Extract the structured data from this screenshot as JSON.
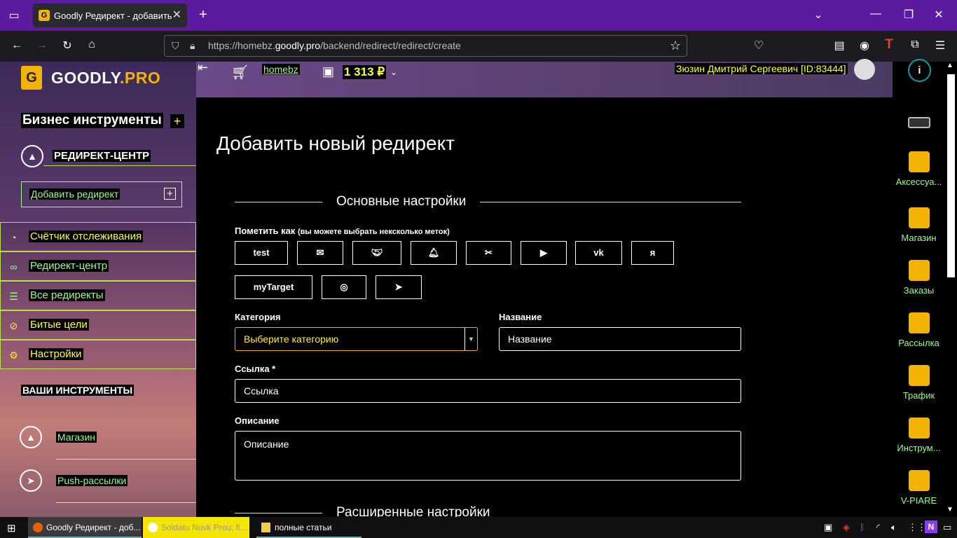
{
  "browser": {
    "tab_title": "Goodly Редирект - добавить",
    "url_prefix": "https://homebz.",
    "url_domain": "goodly.pro",
    "url_path": "/backend/redirect/redirect/create"
  },
  "sidebar": {
    "logo_text_a": "GOODLY",
    "logo_text_b": ".PRO",
    "section_title": "Бизнес инструменты",
    "section_expand": "+",
    "group_label": "РЕДИРЕКТ-ЦЕНТР",
    "add_redirect": "Добавить редирект",
    "items": [
      {
        "label": "Счётчик отслеживания",
        "icon": "gauge-icon"
      },
      {
        "label": "Редирект-центр",
        "icon": "link-icon"
      },
      {
        "label": "Все редиректы",
        "icon": "list-icon"
      },
      {
        "label": "Битые цели",
        "icon": "ban-icon"
      },
      {
        "label": "Настройки",
        "icon": "gear-icon"
      }
    ],
    "tools_title": "ВАШИ ИНСТРУМЕНТЫ",
    "tools": [
      {
        "label": "Магазин",
        "icon": "bag-icon"
      },
      {
        "label": "Push-рассылки",
        "icon": "send-icon"
      }
    ]
  },
  "header": {
    "shop_link": "homebz",
    "balance": "1 313 ₽",
    "user": "Зюзин Дмитрий Сергеевич [ID:83444]"
  },
  "rightbar": {
    "items": [
      {
        "label": "Аксессуа..."
      },
      {
        "label": "Магазин"
      },
      {
        "label": "Заказы"
      },
      {
        "label": "Рассылка"
      },
      {
        "label": "Трафик"
      },
      {
        "label": "Инструм..."
      },
      {
        "label": "V-PIARE"
      }
    ]
  },
  "main": {
    "page_title": "Добавить новый редирект",
    "section_basic": "Основные настройки",
    "tags_label": "Пометить как",
    "tags_hint": "(вы можете выбрать нексколько меток)",
    "tags": [
      "test",
      "myTarget"
    ],
    "category_label": "Категория",
    "category_placeholder": "Выберите категорию",
    "name_label": "Название",
    "name_placeholder": "Название",
    "link_label": "Ссылка *",
    "link_placeholder": "Ссылка",
    "desc_label": "Описание",
    "desc_placeholder": "Описание",
    "section_advanced": "Расширенные настройки"
  },
  "taskbar": {
    "apps": [
      "Goodly Редирект - доб...",
      "Soldatu Nuvk Prou, fi...",
      "полные статьи"
    ]
  },
  "colors": {
    "accent": "#f2b400",
    "green_text": "#9dfc8a",
    "yellow_text": "#ffff3c",
    "tab_purple": "#5b1aa0"
  }
}
